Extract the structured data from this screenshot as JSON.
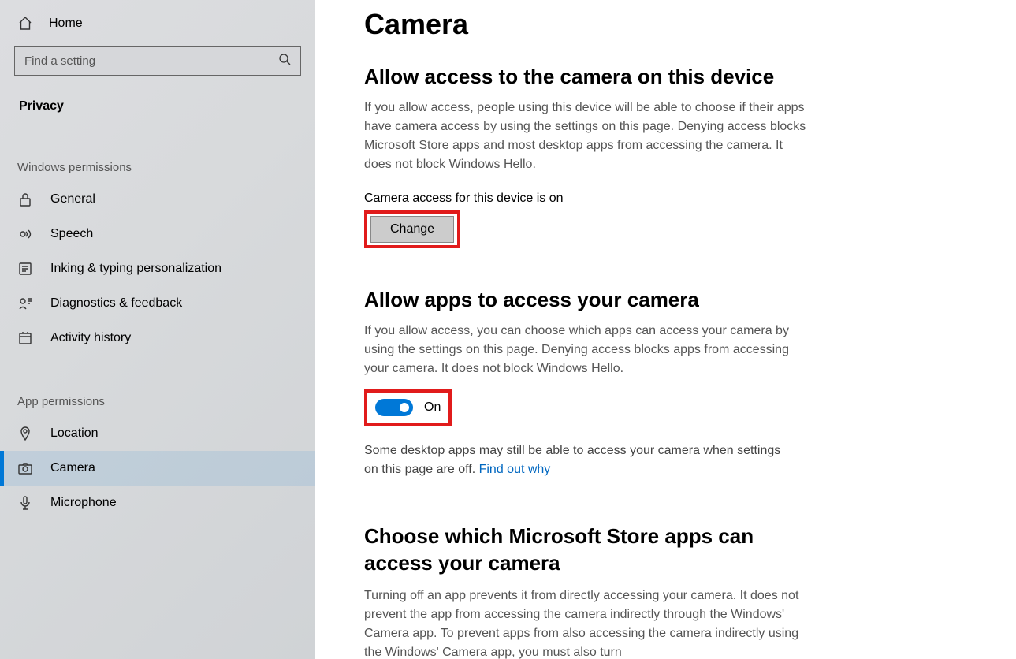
{
  "sidebar": {
    "home": "Home",
    "search_placeholder": "Find a setting",
    "category": "Privacy",
    "section_windows": "Windows permissions",
    "items_windows": [
      {
        "label": "General"
      },
      {
        "label": "Speech"
      },
      {
        "label": "Inking & typing personalization"
      },
      {
        "label": "Diagnostics & feedback"
      },
      {
        "label": "Activity history"
      }
    ],
    "section_app": "App permissions",
    "items_app": [
      {
        "label": "Location"
      },
      {
        "label": "Camera"
      },
      {
        "label": "Microphone"
      }
    ]
  },
  "main": {
    "title": "Camera",
    "section1_heading": "Allow access to the camera on this device",
    "section1_desc": "If you allow access, people using this device will be able to choose if their apps have camera access by using the settings on this page. Denying access blocks Microsoft Store apps and most desktop apps from accessing the camera. It does not block Windows Hello.",
    "section1_status": "Camera access for this device is on",
    "change_label": "Change",
    "section2_heading": "Allow apps to access your camera",
    "section2_desc": "If you allow access, you can choose which apps can access your camera by using the settings on this page. Denying access blocks apps from accessing your camera. It does not block Windows Hello.",
    "toggle_label": "On",
    "after_toggle_text": "Some desktop apps may still be able to access your camera when settings on this page are off. ",
    "after_toggle_link": "Find out why",
    "section3_heading": "Choose which Microsoft Store apps can access your camera",
    "section3_desc": "Turning off an app prevents it from directly accessing your camera. It does not prevent the app from accessing the camera indirectly through the Windows' Camera app. To prevent apps from also accessing the camera indirectly using the Windows' Camera app, you must also turn"
  }
}
